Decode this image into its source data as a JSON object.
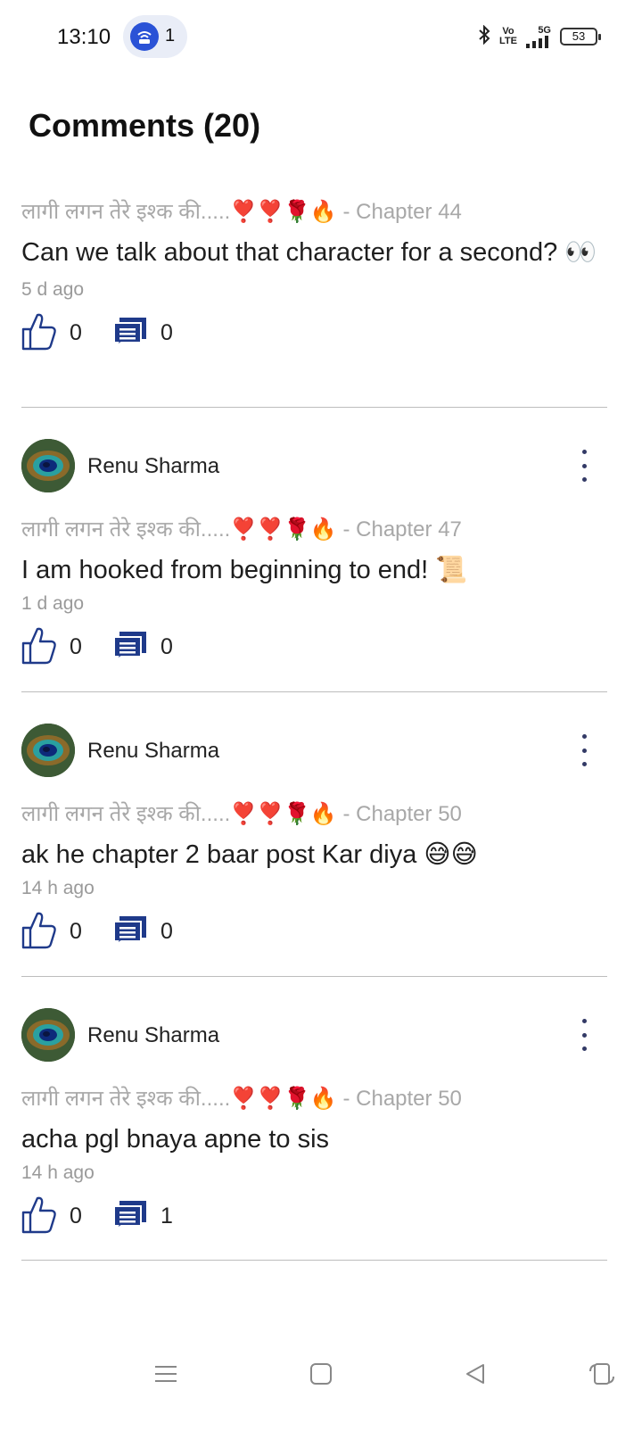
{
  "status_bar": {
    "time": "13:10",
    "notification_count": "1",
    "network": "5G",
    "volte": "Vo\nLTE",
    "battery": "53",
    "icons": [
      "hotspot-icon",
      "bluetooth-icon",
      "volte-icon",
      "signal-icon",
      "battery-icon"
    ]
  },
  "header": {
    "title": "Comments (20)"
  },
  "comments": [
    {
      "user": "",
      "book": "लागी लगन तेरे इश्क की.....",
      "book_emoji": "❣️❣️🌹🔥",
      "chapter": " - Chapter 44",
      "text": "Can we talk about that character for a second? 👀",
      "time": "5 d ago",
      "likes": "0",
      "replies": "0"
    },
    {
      "user": "Renu Sharma",
      "book": "लागी लगन तेरे इश्क की.....",
      "book_emoji": "❣️❣️🌹🔥",
      "chapter": " - Chapter 47",
      "text": "I am hooked from beginning to end! 📜",
      "time": "1 d ago",
      "likes": "0",
      "replies": "0"
    },
    {
      "user": "Renu Sharma",
      "book": "लागी लगन तेरे इश्क की.....",
      "book_emoji": "❣️❣️🌹🔥",
      "chapter": " - Chapter 50",
      "text": "ak he chapter 2 baar post Kar diya 😅😅",
      "time": "14 h ago",
      "likes": "0",
      "replies": "0"
    },
    {
      "user": "Renu Sharma",
      "book": "लागी लगन तेरे इश्क की.....",
      "book_emoji": "❣️❣️🌹🔥",
      "chapter": " - Chapter 50",
      "text": "acha pgl bnaya apne to sis",
      "time": "14 h ago",
      "likes": "0",
      "replies": "1"
    }
  ],
  "colors": {
    "accent": "#1f3a8a",
    "muted": "#a8a8a8",
    "divider": "#bdbdbd"
  },
  "nav_bar": {
    "icons": [
      "menu-icon",
      "home-icon",
      "back-icon",
      "rotate-icon"
    ]
  }
}
